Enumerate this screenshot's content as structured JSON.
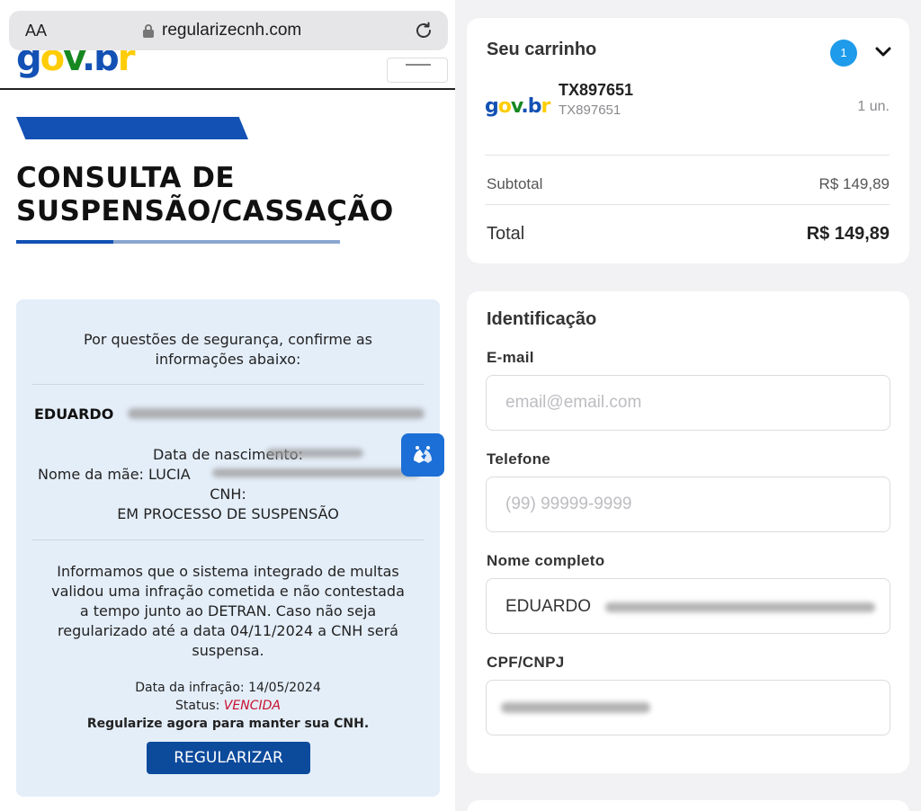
{
  "browser": {
    "text_size_button": "AA",
    "url": "regularizecnh.com"
  },
  "site": {
    "logo_text": "gov.br",
    "page_title_line1": "CONSULTA DE",
    "page_title_line2": "SUSPENSÃO/CASSAÇÃO"
  },
  "notice": {
    "security_line1": "Por questões de segurança, confirme as",
    "security_line2": "informações abaixo:",
    "name": "EDUARDO",
    "birth_label": "Data de nascimento:",
    "mother_label": "Nome da mãe: LUCIA",
    "cnh_label": "CNH:",
    "cnh_status": "EM PROCESSO DE SUSPENSÃO",
    "para_line1": "Informamos que o sistema integrado de multas",
    "para_line2": "validou uma infração cometida e não contestada",
    "para_line3": "a tempo junto ao DETRAN. Caso não seja",
    "para_line4": "regularizado até a data 04/11/2024 a CNH será",
    "para_line5": "suspensa.",
    "infraction_date": "Data da infração: 14/05/2024",
    "status_label": "Status:",
    "status_value": "VENCIDA",
    "call_to_action": "Regularize agora para manter sua CNH.",
    "button_label": "REGULARIZAR"
  },
  "cart": {
    "title": "Seu carrinho",
    "badge_count": "1",
    "item_logo": "gov.br",
    "item_name": "TX897651",
    "item_sku": "TX897651",
    "item_qty": "1 un.",
    "subtotal_label": "Subtotal",
    "subtotal_value": "R$ 149,89",
    "total_label": "Total",
    "total_value": "R$ 149,89"
  },
  "identification": {
    "title": "Identificação",
    "email_label": "E-mail",
    "email_placeholder": "email@email.com",
    "phone_label": "Telefone",
    "phone_placeholder": "(99) 99999-9999",
    "fullname_label": "Nome completo",
    "fullname_value": "EDUARDO",
    "doc_label": "CPF/CNPJ"
  },
  "colors": {
    "gov_blue": "#1351b4",
    "button_blue": "#0c4a9c",
    "badge_blue": "#1e9bea",
    "alert_red": "#c8102e",
    "card_bg": "#e4eef9"
  },
  "icons": [
    "lock-icon",
    "reload-icon",
    "menu-icon",
    "sign-language-icon",
    "chevron-down-icon"
  ]
}
